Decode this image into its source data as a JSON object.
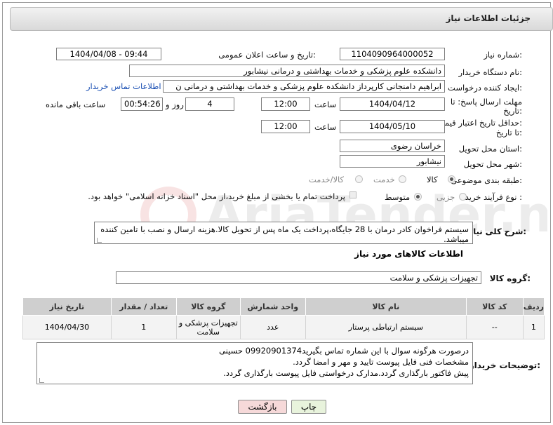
{
  "header": {
    "title": "جزئیات اطلاعات نیاز"
  },
  "fields": {
    "need_number_label": "شماره نیاز:",
    "need_number": "1104090964000052",
    "announce_label": "تاریخ و ساعت اعلان عمومی:",
    "announce_value": "1404/04/08 - 09:44",
    "buyer_org_label": "نام دستگاه خریدار:",
    "buyer_org": "دانشکده علوم پزشکی و خدمات بهداشتی و درمانی نیشابور",
    "creator_label": "ایجاد کننده درخواست:",
    "creator": "ابراهیم دامنجانی  کارپرداز دانشکده علوم پزشکی و خدمات بهداشتی و درمانی ن",
    "contact_link": "اطلاعات تماس خریدار",
    "deadline_label_1": "مهلت ارسال پاسخ: تا",
    "deadline_label_2": "تاریخ:",
    "deadline_date": "1404/04/12",
    "hour_label": "ساعت",
    "deadline_time": "12:00",
    "days_value": "4",
    "days_label": "روز و",
    "remaining_time": "00:54:26",
    "remaining_label": "ساعت باقی مانده",
    "price_label_1": "حداقل تاریخ اعتبار قیمت:",
    "price_label_2": "تا تاریخ:",
    "price_date": "1404/05/10",
    "price_time": "12:00",
    "province_label": "استان محل تحویل:",
    "province": "خراسان رضوی",
    "city_label": "شهر محل تحویل:",
    "city": "نیشابور",
    "category_label": "طبقه بندی موضوعی:",
    "category_options": [
      "کالا",
      "خدمت",
      "کالا/خدمت"
    ],
    "process_label": "نوع فرآیند خرید :",
    "process_options": [
      "جزیی",
      "متوسط"
    ],
    "payment_note": "پرداخت تمام یا بخشی از مبلغ خرید،از محل \"اسناد خزانه اسلامی\" خواهد بود.",
    "summary_label": "شرح کلی نیاز:",
    "summary": "سیستم فراخوان کادر درمان با 28 جایگاه،پرداخت یک ماه پس از تحویل کالا.هزینه ارسال و نصب با تامین کننده میباشد."
  },
  "goods": {
    "section_title": "اطلاعات کالاهای مورد نیاز",
    "group_label": "گروه کالا:",
    "group_value": "تجهیزات پزشکی و سلامت",
    "columns": [
      "ردیف",
      "کد کالا",
      "نام کالا",
      "واحد شمارش",
      "گروه کالا",
      "تعداد / مقدار",
      "تاریخ نیاز"
    ],
    "rows": [
      [
        "1",
        "--",
        "سیستم ارتباطی پرستار",
        "عدد",
        "تجهیزات پزشکی و سلامت",
        "1",
        "1404/04/30"
      ]
    ]
  },
  "buyer_notes": {
    "label": "توضیحات خریدار:",
    "lines": [
      "درصورت هرگونه سوال با این شماره تماس بگیرید09920901374 حسینی",
      "مشخصات فنی فایل پیوست تایید و مهر و امضا گردد.",
      "پیش فاکتور بارگذاری گردد.مدارک درخواستی فایل پیوست بارگذاری گردد."
    ]
  },
  "buttons": {
    "print": "چاپ",
    "back": "بازگشت"
  },
  "watermark": {
    "text": "AriaTender.neT"
  },
  "colors": {
    "link": "#1a4fb3",
    "back_button": "#f6d9d9",
    "print_button": "#e8f3dc"
  }
}
